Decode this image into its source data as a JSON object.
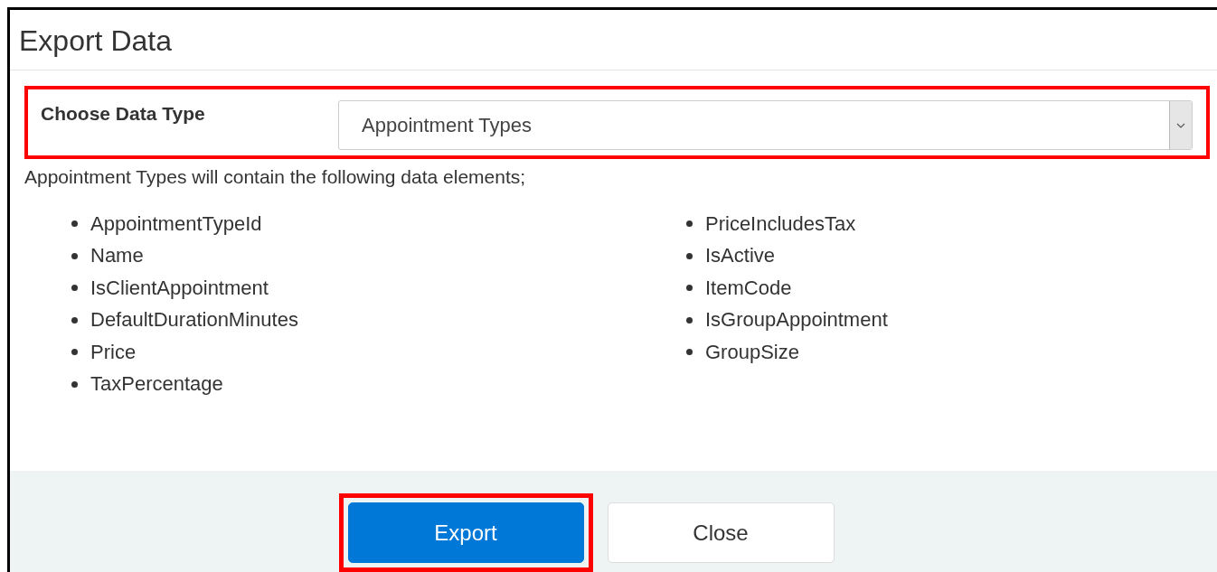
{
  "dialog": {
    "title": "Export Data"
  },
  "data_type": {
    "label": "Choose Data Type",
    "value": "Appointment Types",
    "highlighted": true
  },
  "description": "Appointment Types will contain the following data elements;",
  "elements": [
    [
      "AppointmentTypeId",
      "Name",
      "IsClientAppointment",
      "DefaultDurationMinutes",
      "Price",
      "TaxPercentage"
    ],
    [
      "PriceIncludesTax",
      "IsActive",
      "ItemCode",
      "IsGroupAppointment",
      "GroupSize"
    ]
  ],
  "buttons": [
    {
      "label": "Export",
      "kind": "primary",
      "highlighted": true
    },
    {
      "label": "Close",
      "kind": "default",
      "highlighted": false
    }
  ]
}
